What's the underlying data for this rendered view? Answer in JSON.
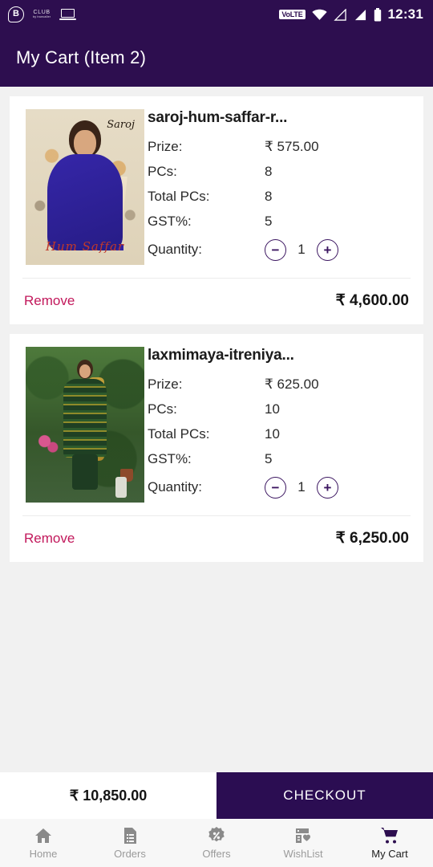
{
  "status_bar": {
    "left_icons": [
      "b-chat-bubble-icon",
      "club-logo",
      "laptop-icon"
    ],
    "club_label": "CLUB",
    "club_sub": "by truecaller",
    "network_badge": "VoLTE",
    "right_icons": [
      "wifi-icon",
      "signal-empty-icon",
      "signal-full-icon",
      "battery-icon"
    ],
    "time": "12:31"
  },
  "header": {
    "title": "My Cart (Item 2)"
  },
  "labels": {
    "prize": "Prize:",
    "pcs": "PCs:",
    "total_pcs": "Total PCs:",
    "gst": "GST%:",
    "quantity": "Quantity:",
    "remove": "Remove",
    "minus": "−",
    "plus": "+"
  },
  "cart_items": [
    {
      "title": "saroj-hum-saffar-r...",
      "prize": "₹ 575.00",
      "pcs": "8",
      "total_pcs": "8",
      "gst": "5",
      "quantity": "1",
      "line_total": "₹ 4,600.00",
      "thumb_brand": "Saroj",
      "thumb_caption": "Hum Saffar"
    },
    {
      "title": "laxmimaya-itreniya...",
      "prize": "₹ 625.00",
      "pcs": "10",
      "total_pcs": "10",
      "gst": "5",
      "quantity": "1",
      "line_total": "₹ 6,250.00",
      "thumb_brand": "",
      "thumb_caption": ""
    }
  ],
  "checkout_bar": {
    "grand_total": "₹ 10,850.00",
    "checkout_label": "CHECKOUT"
  },
  "bottom_nav": {
    "items": [
      {
        "label": "Home",
        "icon": "home-icon",
        "active": false
      },
      {
        "label": "Orders",
        "icon": "document-icon",
        "active": false
      },
      {
        "label": "Offers",
        "icon": "percent-badge-icon",
        "active": false
      },
      {
        "label": "WishList",
        "icon": "list-heart-icon",
        "active": false
      },
      {
        "label": "My Cart",
        "icon": "shopping-cart-icon",
        "active": true
      }
    ]
  },
  "colors": {
    "header_purple": "#2d0e4f",
    "checkout_purple": "#2b0d52",
    "remove_pink": "#c2185b",
    "page_bg": "#f1f1f1",
    "nav_inactive": "#8a8a8a"
  }
}
